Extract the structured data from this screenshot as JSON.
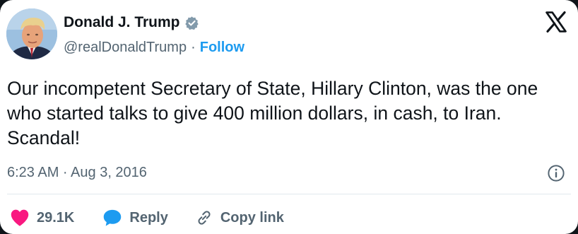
{
  "author": {
    "display_name": "Donald J. Trump",
    "handle": "@realDonaldTrump",
    "separator": "·",
    "follow_label": "Follow"
  },
  "tweet": {
    "text": "Our incompetent Secretary of State, Hillary Clinton, was the one who started talks to give 400 million dollars, in cash, to Iran. Scandal!",
    "timestamp": "6:23 AM · Aug 3, 2016"
  },
  "actions": {
    "likes_count": "29.1K",
    "reply_label": "Reply",
    "copy_link_label": "Copy link"
  },
  "icons": {
    "avatar": "avatar-photo",
    "verified": "verified-badge-icon",
    "x_logo": "x-logo-icon",
    "info": "info-icon",
    "like": "heart-icon",
    "reply": "speech-bubble-icon",
    "copy": "link-icon"
  },
  "colors": {
    "follow": "#1d9bf0",
    "heart": "#f91880",
    "reply_bubble": "#1d9bf0",
    "muted_text": "#536471",
    "verified_badge": "#829aab"
  }
}
